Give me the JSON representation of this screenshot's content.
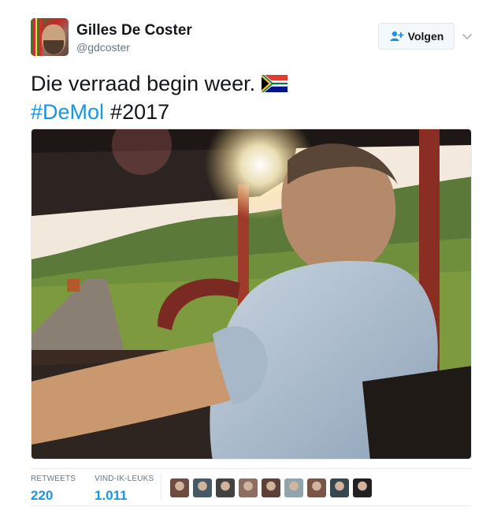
{
  "author": {
    "name": "Gilles De Coster",
    "handle": "@gdcoster"
  },
  "follow_button": {
    "label": "Volgen",
    "icon": "follow-person-plus-icon"
  },
  "menu_icon": "chevron-down-icon",
  "tweet": {
    "text": "Die verraad begin weer.",
    "flag_emoji": "south-africa-flag",
    "hashtag_link": "#DeMol",
    "hashtag_plain": "#2017"
  },
  "stats": {
    "retweets_label": "RETWEETS",
    "retweets_value": "220",
    "likes_label": "VIND-IK-LEUKS",
    "likes_value": "1.011"
  },
  "liker_avatars": [
    {
      "name": "liker-avatar-1",
      "color": "#6d4c41"
    },
    {
      "name": "liker-avatar-2",
      "color": "#455a64"
    },
    {
      "name": "liker-avatar-3",
      "color": "#424242"
    },
    {
      "name": "liker-avatar-4",
      "color": "#8d6e63"
    },
    {
      "name": "liker-avatar-5",
      "color": "#5d4037"
    },
    {
      "name": "liker-avatar-6",
      "color": "#90a4ae"
    },
    {
      "name": "liker-avatar-7",
      "color": "#795548"
    },
    {
      "name": "liker-avatar-8",
      "color": "#37474f"
    },
    {
      "name": "liker-avatar-9",
      "color": "#212121"
    }
  ],
  "colors": {
    "link": "#1b95e0",
    "text": "#14171a",
    "muted": "#657786"
  }
}
